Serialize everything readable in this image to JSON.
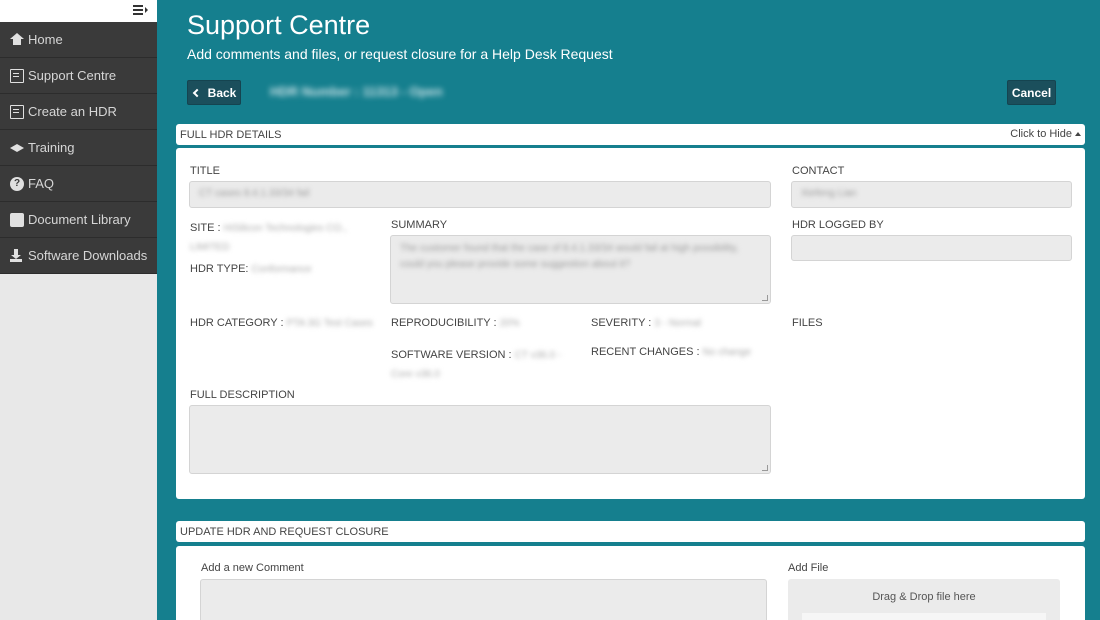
{
  "sidebar": {
    "items": [
      {
        "label": "Home",
        "icon": "home-icon"
      },
      {
        "label": "Support Centre",
        "icon": "document-icon"
      },
      {
        "label": "Create an HDR",
        "icon": "create-document-icon"
      },
      {
        "label": "Training",
        "icon": "graduation-cap-icon"
      },
      {
        "label": "FAQ",
        "icon": "question-circle-icon"
      },
      {
        "label": "Document Library",
        "icon": "box-icon"
      },
      {
        "label": "Software Downloads",
        "icon": "download-icon"
      }
    ]
  },
  "header": {
    "title": "Support Centre",
    "subtitle": "Add comments and files, or request closure for a Help Desk Request",
    "back_label": "Back",
    "cancel_label": "Cancel",
    "hdr_number": "HDR Number : 11313 - Open"
  },
  "details": {
    "header": "FULL HDR DETAILS",
    "toggle_label": "Click to Hide",
    "title_label": "TITLE",
    "title_value": "CT cases 8.4.1.33/34 fail",
    "contact_label": "CONTACT",
    "contact_value": "Xiefeng Lian",
    "site_label": "SITE :",
    "site_value": "HiSilicon Technologies CO., LIMITED",
    "summary_label": "SUMMARY",
    "summary_value": "The customer found that the case of 8.4.1.33/34 would fail at high possibility, could you please provide some suggestion about it?",
    "logged_by_label": "HDR LOGGED BY",
    "logged_by_value": "",
    "hdr_type_label": "HDR TYPE:",
    "hdr_type_value": "Conformance",
    "category_label": "HDR CATEGORY :",
    "category_value": "PTA 3G Test Cases",
    "reproducibility_label": "REPRODUCIBILITY :",
    "reproducibility_value": "20%",
    "severity_label": "SEVERITY :",
    "severity_value": "3 - Normal",
    "files_label": "FILES",
    "software_version_label": "SOFTWARE VERSION :",
    "software_version_value": "CT v36.0 - Core v36.0",
    "recent_changes_label": "RECENT CHANGES :",
    "recent_changes_value": "No change",
    "full_description_label": "FULL DESCRIPTION",
    "full_description_value": ""
  },
  "update": {
    "header": "UPDATE HDR AND REQUEST CLOSURE",
    "comment_label": "Add a new Comment",
    "file_label": "Add File",
    "dropzone_text": "Drag & Drop file here"
  }
}
